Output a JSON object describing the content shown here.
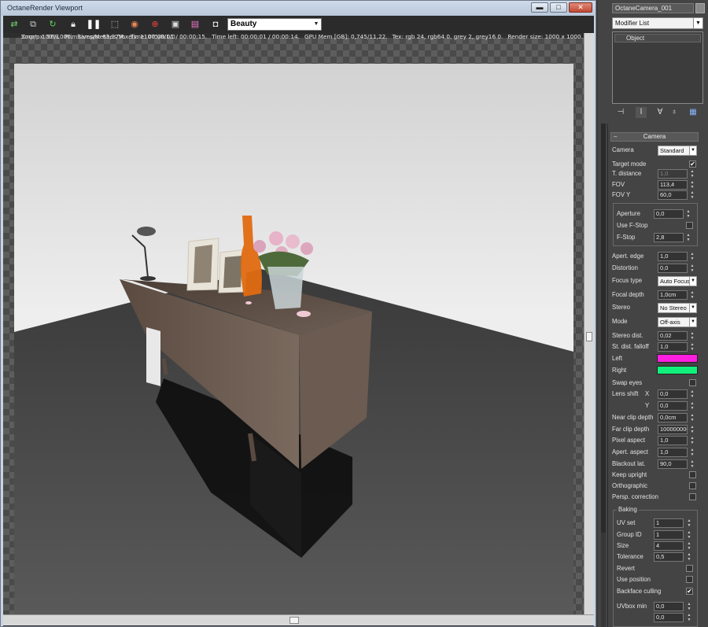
{
  "window": {
    "title": "OctaneRender Viewport",
    "minimize": "▬",
    "maximize": "□",
    "close": "✕"
  },
  "toolbar": {
    "icons": [
      "send-to-octane-icon",
      "copy-render-icon",
      "restart-render-icon",
      "lock-icon",
      "pause-icon",
      "region-render-icon",
      "color-picker-icon",
      "focus-picker-icon",
      "save-image-icon",
      "clapper-icon",
      "film-icon"
    ],
    "pass": "Beauty"
  },
  "stats": {
    "line1": [
      "Smp/px: 96/1000.",
      "Samp/s: 63,27M.",
      "Time: 00:00:01 / 00:00:15.",
      "Time left: 00:00:01 / 00:00:14.",
      "GPU Mem [GB]: 0,745/11,22.",
      "Tex: rgb 24, rgb64 0, grey 2, grey16 0.",
      "Render size: 1000 x 1000."
    ],
    "line2": [
      "Zoom: 100%.",
      "Primitives/Meshes/Voxels: 11075/8/1/0"
    ]
  },
  "panel": {
    "object_name": "OctaneCamera_001",
    "modifier_list": "Modifier List",
    "stack_items": [
      "Object"
    ],
    "rollout_title": "Camera",
    "rollout_marker": "–",
    "camera": {
      "label": "Camera",
      "value": "Standard"
    },
    "target_mode": {
      "label": "Target mode",
      "checked": "✔"
    },
    "t_distance": {
      "label": "T. distance",
      "value": "1,0"
    },
    "fov": {
      "label": "FOV",
      "value": "113,4"
    },
    "fov_y": {
      "label": "FOV Y",
      "value": "60,0"
    },
    "aperture": {
      "label": "Aperture",
      "value": "0,0"
    },
    "use_fstop": {
      "label": "Use F-Stop"
    },
    "fstop": {
      "label": "F-Stop",
      "value": "2,8"
    },
    "apert_edge": {
      "label": "Apert. edge",
      "value": "1,0"
    },
    "distortion": {
      "label": "Distortion",
      "value": "0,0"
    },
    "focus_type": {
      "label": "Focus type",
      "value": "Auto Focus"
    },
    "focal_depth": {
      "label": "Focal depth",
      "value": "1,0cm"
    },
    "stereo": {
      "label": "Stereo",
      "value": "No Stereo"
    },
    "mode": {
      "label": "Mode",
      "value": "Off-axis"
    },
    "stereo_dist": {
      "label": "Stereo dist.",
      "value": "0,02"
    },
    "st_dist_falloff": {
      "label": "St. dist. falloff",
      "value": "1,0"
    },
    "left": {
      "label": "Left",
      "color": "#ff1ee0"
    },
    "right": {
      "label": "Right",
      "color": "#12f07c"
    },
    "swap_eyes": {
      "label": "Swap eyes"
    },
    "lens_shift": {
      "label": "Lens shift",
      "x_label": "X",
      "x": "0,0",
      "y_label": "Y",
      "y": "0,0"
    },
    "near_clip": {
      "label": "Near clip depth",
      "value": "0,0cm"
    },
    "far_clip": {
      "label": "Far clip depth",
      "value": "100000000"
    },
    "pixel_aspect": {
      "label": "Pixel aspect",
      "value": "1,0"
    },
    "apert_aspect": {
      "label": "Apert. aspect",
      "value": "1,0"
    },
    "blackout_lat": {
      "label": "Blackout lat.",
      "value": "90,0"
    },
    "keep_upright": {
      "label": "Keep upright"
    },
    "orthographic": {
      "label": "Orthographic"
    },
    "persp_correction": {
      "label": "Persp. correction"
    },
    "baking": {
      "title": "Baking",
      "uv_set": {
        "label": "UV set",
        "value": "1"
      },
      "group_id": {
        "label": "Group ID",
        "value": "1"
      },
      "size": {
        "label": "Size",
        "value": "4"
      },
      "tolerance": {
        "label": "Tolerance",
        "value": "0,5"
      },
      "revert": {
        "label": "Revert"
      },
      "use_position": {
        "label": "Use position"
      },
      "backface_culling": {
        "label": "Backface culling",
        "checked": "✔"
      },
      "uvbox_min": {
        "label": "UVbox min",
        "v1": "0,0",
        "v2": "0,0"
      }
    }
  }
}
